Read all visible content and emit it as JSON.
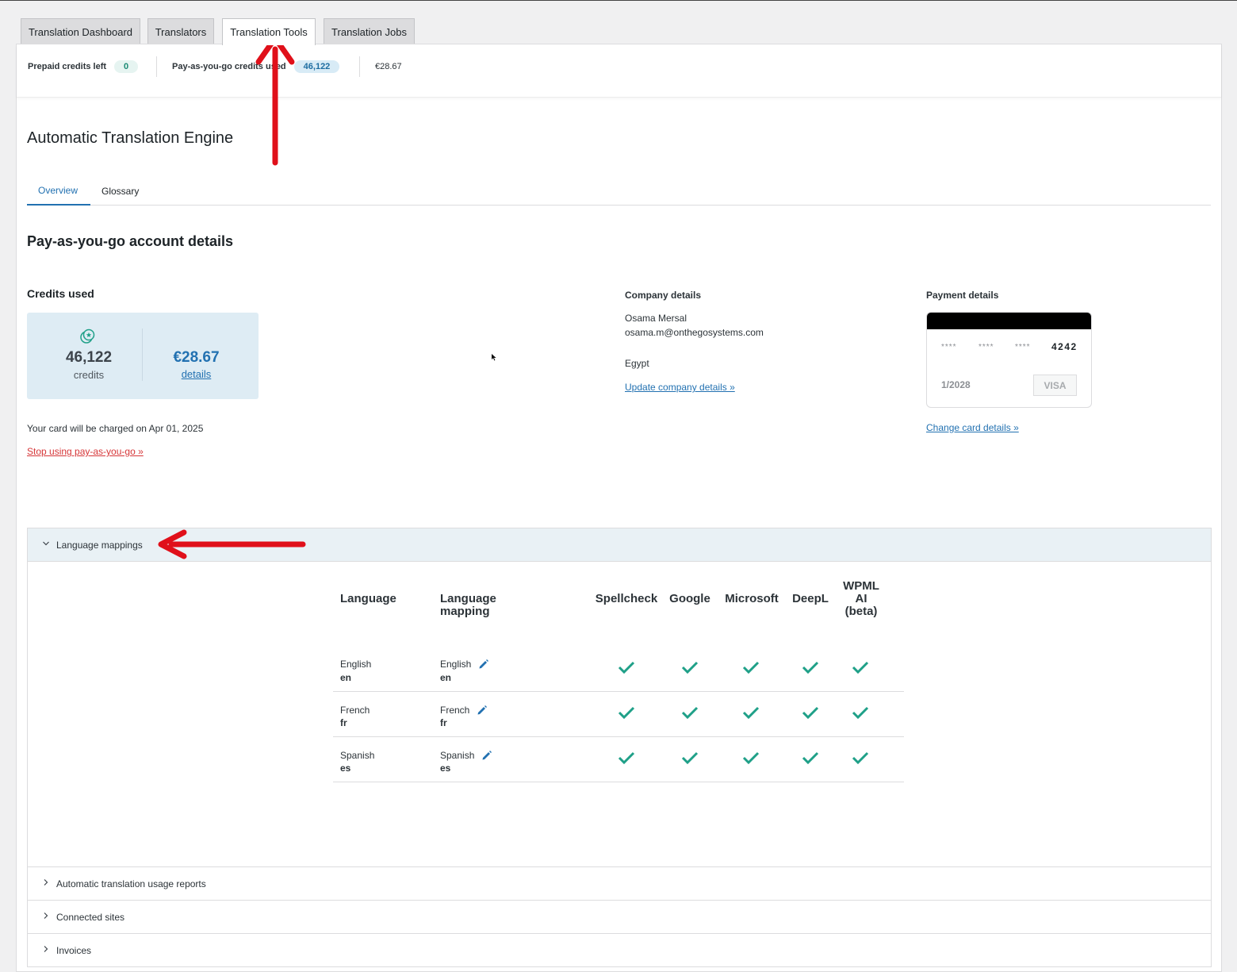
{
  "tabs": [
    {
      "label": "Translation Dashboard",
      "active": false
    },
    {
      "label": "Translators",
      "active": false
    },
    {
      "label": "Translation Tools",
      "active": true
    },
    {
      "label": "Translation Jobs",
      "active": false
    }
  ],
  "credits_bar": {
    "prepaid_label": "Prepaid credits left",
    "prepaid_value": "0",
    "payg_label": "Pay-as-you-go credits used",
    "payg_value": "46,122",
    "amount": "€28.67"
  },
  "page_title": "Automatic Translation Engine",
  "subtabs": [
    {
      "label": "Overview",
      "active": true
    },
    {
      "label": "Glossary",
      "active": false
    }
  ],
  "account": {
    "heading": "Pay-as-you-go account details",
    "credits_used_heading": "Credits used",
    "credits_value": "46,122",
    "credits_label": "credits",
    "amount_value": "€28.67",
    "details_link": "details",
    "charge_note": "Your card will be charged on Apr 01, 2025",
    "stop_link": "Stop using pay-as-you-go »"
  },
  "company": {
    "heading": "Company details",
    "name": "Osama Mersal",
    "email": "osama.m@onthegosystems.com",
    "country": "Egypt",
    "update_link": "Update company details »"
  },
  "payment": {
    "heading": "Payment details",
    "masked_group": "****",
    "last_four": "4242",
    "expiry": "1/2028",
    "brand": "VISA",
    "change_link": "Change card details »"
  },
  "sections": {
    "language_mappings": "Language mappings",
    "usage_reports": "Automatic translation usage reports",
    "connected_sites": "Connected sites",
    "invoices": "Invoices"
  },
  "mapping_table": {
    "columns": [
      "Language",
      "Language mapping",
      "Spellcheck",
      "Google",
      "Microsoft",
      "DeepL",
      "WPML AI (beta)"
    ],
    "rows": [
      {
        "language": "English",
        "code": "en",
        "mapping": "English",
        "mapping_code": "en",
        "spellcheck": true,
        "google": true,
        "microsoft": true,
        "deepl": true,
        "wpml_ai": true
      },
      {
        "language": "French",
        "code": "fr",
        "mapping": "French",
        "mapping_code": "fr",
        "spellcheck": true,
        "google": true,
        "microsoft": true,
        "deepl": true,
        "wpml_ai": true
      },
      {
        "language": "Spanish",
        "code": "es",
        "mapping": "Spanish",
        "mapping_code": "es",
        "spellcheck": true,
        "google": true,
        "microsoft": true,
        "deepl": true,
        "wpml_ai": true
      }
    ]
  },
  "colors": {
    "accent": "#2271b1",
    "check": "#1fa088",
    "danger": "#d63638",
    "annotation": "#e0101a"
  }
}
